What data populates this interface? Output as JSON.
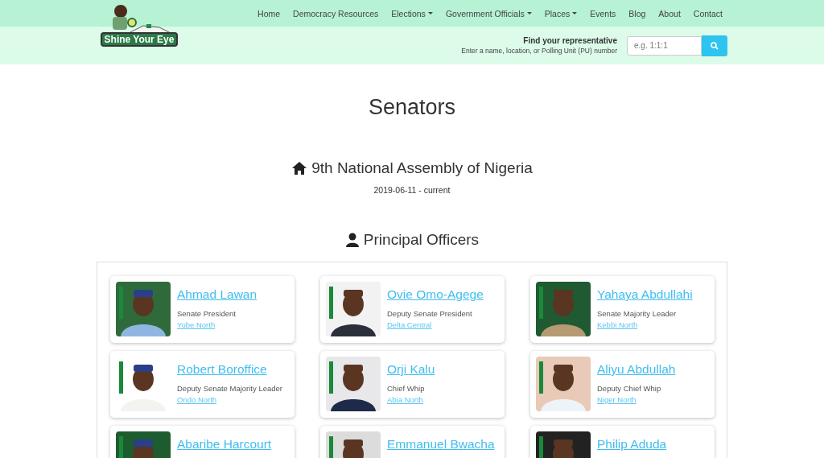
{
  "logo": {
    "text": "Shine Your Eye"
  },
  "nav": [
    {
      "label": "Home",
      "dropdown": false
    },
    {
      "label": "Democracy Resources",
      "dropdown": false
    },
    {
      "label": "Elections",
      "dropdown": true
    },
    {
      "label": "Government Officials",
      "dropdown": true
    },
    {
      "label": "Places",
      "dropdown": true
    },
    {
      "label": "Events",
      "dropdown": false
    },
    {
      "label": "Blog",
      "dropdown": false
    },
    {
      "label": "About",
      "dropdown": false
    },
    {
      "label": "Contact",
      "dropdown": false
    }
  ],
  "finder": {
    "title": "Find your representative",
    "hint": "Enter a name, location, or Polling Unit (PU) number",
    "placeholder": "e.g. 1:1:1"
  },
  "page_title": "Senators",
  "assembly": {
    "title": "9th National Assembly of Nigeria",
    "dates": "2019-06-11 - current"
  },
  "section_title": "Principal Officers",
  "officers": [
    {
      "name": "Ahmad Lawan",
      "role": "Senate President",
      "district": "Yobe North"
    },
    {
      "name": "Ovie Omo-Agege",
      "role": "Deputy Senate President",
      "district": "Delta Central"
    },
    {
      "name": "Yahaya Abdullahi",
      "role": "Senate Majority Leader",
      "district": "Kebbi North"
    },
    {
      "name": "Robert Boroffice",
      "role": "Deputy Senate Majority Leader",
      "district": "Ondo North"
    },
    {
      "name": "Orji Kalu",
      "role": "Chief Whip",
      "district": "Abia North"
    },
    {
      "name": "Aliyu Abdullah",
      "role": "Deputy Chief Whip",
      "district": "Niger North"
    },
    {
      "name": "Abaribe Harcourt"
    },
    {
      "name": "Emmanuel Bwacha"
    },
    {
      "name": "Philip Aduda"
    }
  ]
}
